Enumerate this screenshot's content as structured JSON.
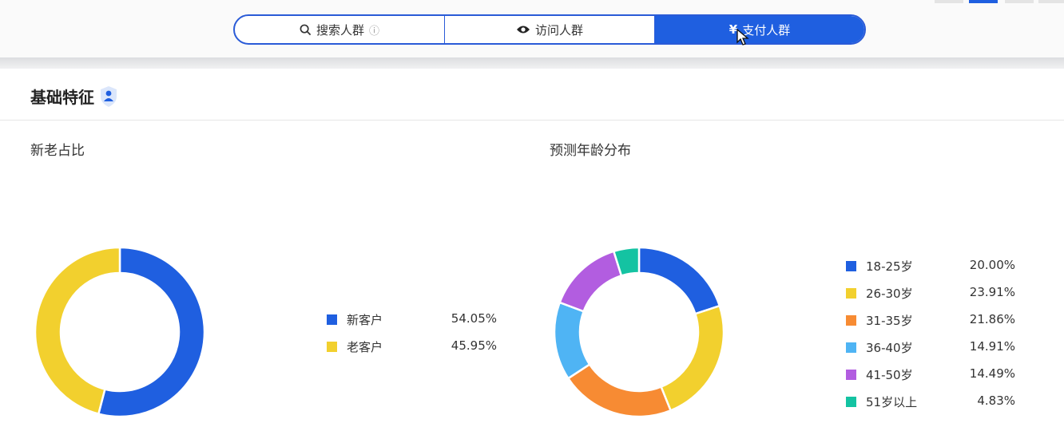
{
  "tabs": [
    {
      "label": "搜索人群",
      "icon": "search-icon",
      "active": false
    },
    {
      "label": "访问人群",
      "icon": "eye-icon",
      "active": false
    },
    {
      "label": "支付人群",
      "icon": "yen-icon",
      "active": true
    }
  ],
  "section": {
    "title": "基础特征",
    "icon": "shield-person-icon"
  },
  "colors": {
    "accent": "#1f5fe0"
  },
  "charts": [
    {
      "title": "新老占比",
      "chart_data": {
        "type": "pie",
        "categories": [
          "新客户",
          "老客户"
        ],
        "values": [
          54.05,
          45.95
        ],
        "labels": [
          "54.05%",
          "45.95%"
        ],
        "colors": [
          "#1f5fe0",
          "#f2d02e"
        ]
      }
    },
    {
      "title": "预测年龄分布",
      "chart_data": {
        "type": "pie",
        "categories": [
          "18-25岁",
          "26-30岁",
          "31-35岁",
          "36-40岁",
          "41-50岁",
          "51岁以上"
        ],
        "values": [
          20.0,
          23.91,
          21.86,
          14.91,
          14.49,
          4.83
        ],
        "labels": [
          "20.00%",
          "23.91%",
          "21.86%",
          "14.91%",
          "14.49%",
          "4.83%"
        ],
        "colors": [
          "#1f5fe0",
          "#f2d02e",
          "#f78b33",
          "#4fb4f4",
          "#b25de0",
          "#14c3a2"
        ]
      }
    }
  ]
}
